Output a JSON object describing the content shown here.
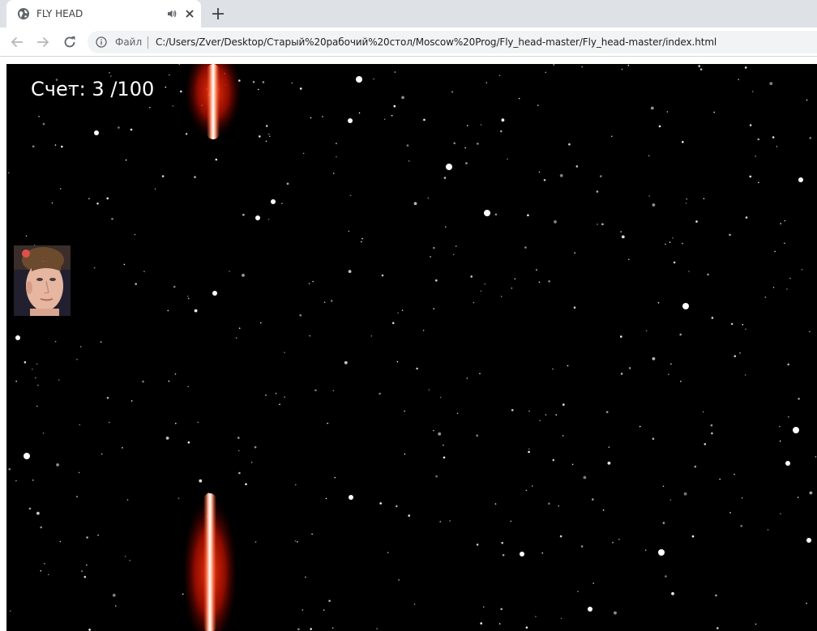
{
  "browser": {
    "tab": {
      "title": "FLY HEAD",
      "favicon": "globe-icon",
      "audio_icon": "speaker-icon",
      "close_icon": "close-icon"
    },
    "new_tab_icon": "plus-icon",
    "nav": {
      "back_icon": "arrow-left-icon",
      "forward_icon": "arrow-right-icon",
      "reload_icon": "reload-icon"
    },
    "address_bar": {
      "info_icon": "info-icon",
      "scheme_label": "Файл",
      "url": "C:/Users/Zver/Desktop/Старый%20рабочий%20стол/Moscow%20Prog/Fly_head-master/Fly_head-master/index.html"
    }
  },
  "game": {
    "score_label": "Счет:",
    "score": "3",
    "score_target": "/100",
    "background_color": "#000000",
    "saber_color": "#ff2000",
    "player_sprite": "head-photo"
  }
}
